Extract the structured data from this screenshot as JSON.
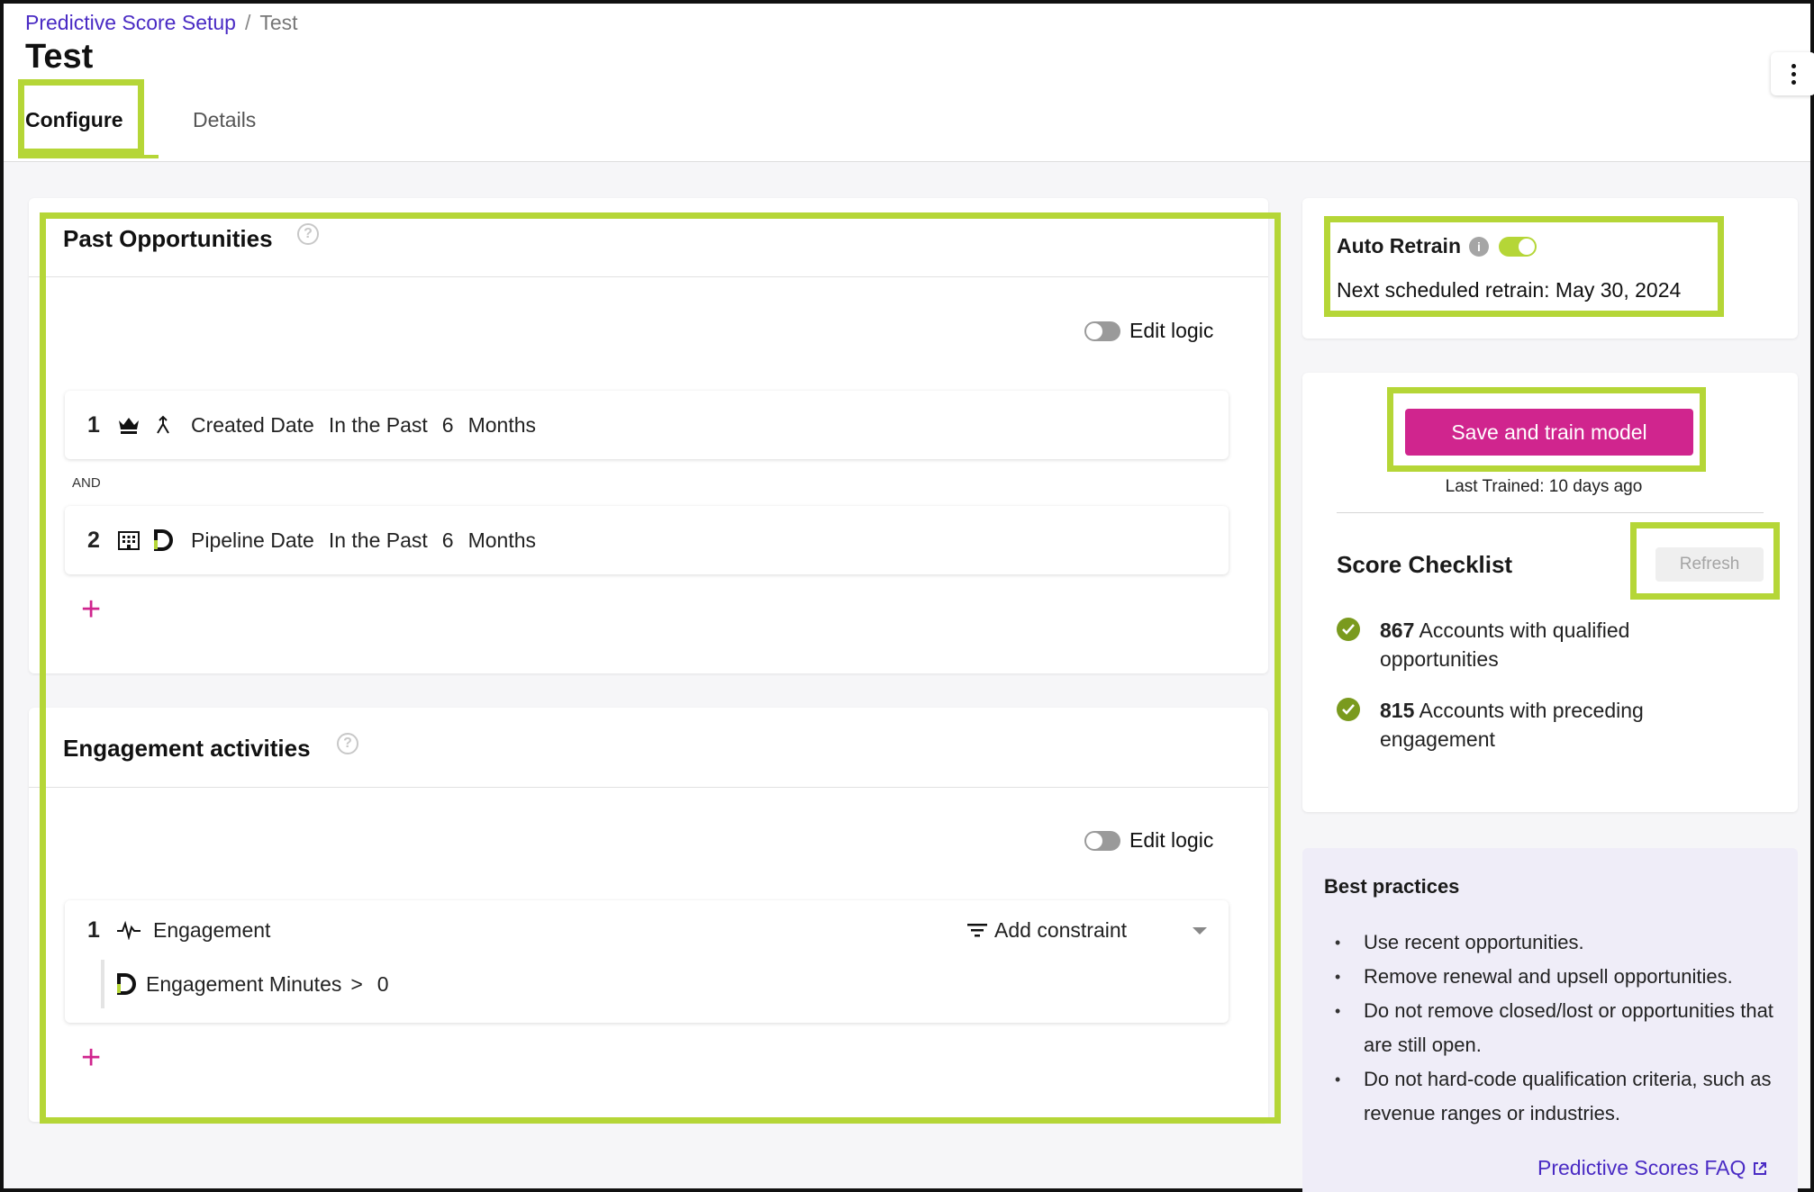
{
  "breadcrumb": {
    "parent": "Predictive Score Setup",
    "separator": "/",
    "current": "Test"
  },
  "page": {
    "title": "Test"
  },
  "tabs": [
    {
      "label": "Configure",
      "active": true
    },
    {
      "label": "Details",
      "active": false
    }
  ],
  "past_opportunities": {
    "title": "Past Opportunities",
    "edit_logic_label": "Edit logic",
    "edit_logic_enabled": false,
    "connector": "AND",
    "rules": [
      {
        "num": "1",
        "icons": [
          "crown-icon",
          "merge-icon"
        ],
        "field": "Created Date",
        "operator": "In the Past",
        "value": "6",
        "unit": "Months"
      },
      {
        "num": "2",
        "icons": [
          "building-icon",
          "d-logo-icon"
        ],
        "field": "Pipeline Date",
        "operator": "In the Past",
        "value": "6",
        "unit": "Months"
      }
    ],
    "add_label": "+"
  },
  "engagement": {
    "title": "Engagement activities",
    "edit_logic_label": "Edit logic",
    "edit_logic_enabled": false,
    "rule": {
      "num": "1",
      "icon": "activity-pulse-icon",
      "label": "Engagement",
      "add_constraint": "Add constraint"
    },
    "sub_rule": {
      "field": "Engagement Minutes",
      "operator": ">",
      "value": "0"
    },
    "add_label": "+"
  },
  "auto_retrain": {
    "label": "Auto Retrain",
    "enabled": true,
    "next_scheduled": "Next scheduled retrain: May 30, 2024"
  },
  "train": {
    "button_label": "Save and train model",
    "last_trained": "Last Trained: 10 days ago"
  },
  "checklist": {
    "title": "Score Checklist",
    "refresh_label": "Refresh",
    "items": [
      {
        "count": "867",
        "text": "Accounts with qualified opportunities"
      },
      {
        "count": "815",
        "text": "Accounts with preceding engagement"
      }
    ]
  },
  "best_practices": {
    "title": "Best practices",
    "items": [
      "Use recent opportunities.",
      "Remove renewal and upsell opportunities.",
      "Do not remove closed/lost or opportunities that are still open.",
      "Do not hard-code qualification criteria, such as revenue ranges or industries."
    ],
    "faq_link": "Predictive Scores FAQ"
  },
  "colors": {
    "accent_link": "#4a2bc4",
    "primary_button": "#d0258e",
    "highlight": "#b5d637",
    "check_green": "#7a9a1e"
  }
}
